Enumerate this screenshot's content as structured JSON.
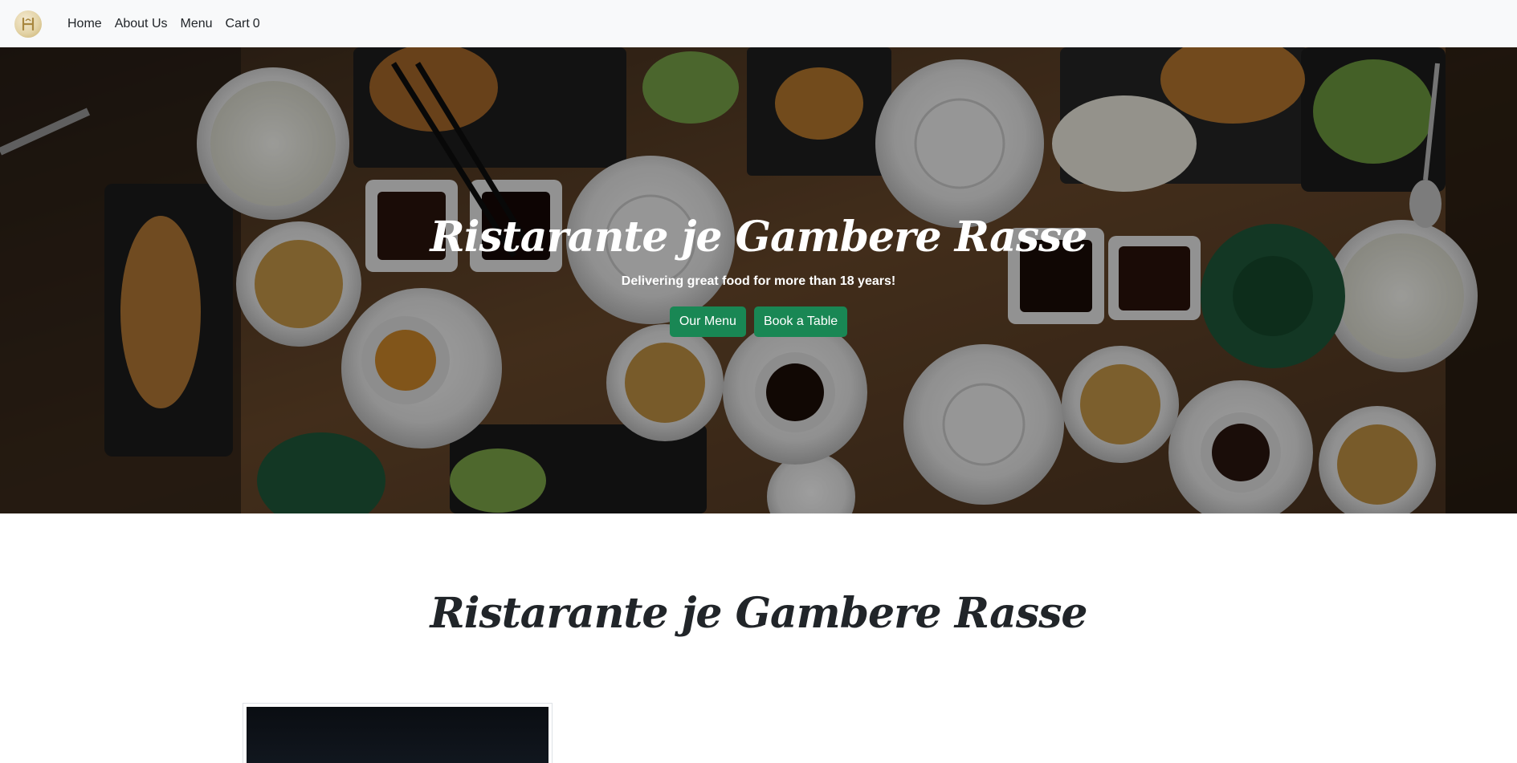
{
  "navbar": {
    "logo_icon": "restaurant-crest-logo",
    "links": [
      {
        "label": "Home"
      },
      {
        "label": "About Us"
      },
      {
        "label": "Menu"
      }
    ],
    "cart": {
      "label": "Cart",
      "count": "0"
    }
  },
  "hero": {
    "title": "Ristarante je Gambere Rasse",
    "subtitle": "Delivering great food for more than 18 years!",
    "buttons": {
      "menu": "Our Menu",
      "book": "Book a Table"
    },
    "button_color": "#198754"
  },
  "about": {
    "title": "Ristarante je Gambere Rasse"
  },
  "colors": {
    "navbar_bg": "#f8f9fa",
    "accent": "#198754",
    "text": "#212529"
  }
}
